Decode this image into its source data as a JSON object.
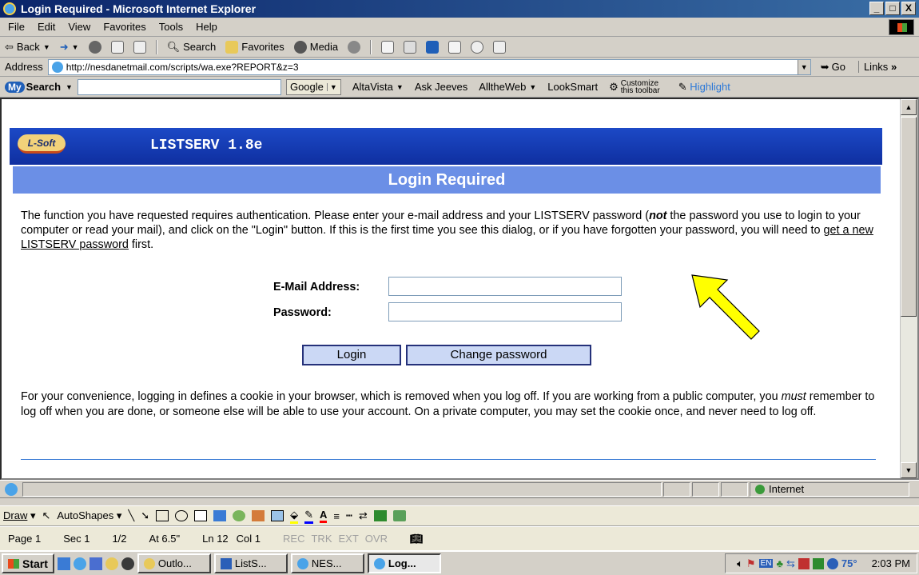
{
  "window": {
    "title": "Login Required - Microsoft Internet Explorer",
    "minimize": "_",
    "maximize": "□",
    "close": "X"
  },
  "menu": [
    "File",
    "Edit",
    "View",
    "Favorites",
    "Tools",
    "Help"
  ],
  "toolbar": {
    "back": "Back",
    "search": "Search",
    "favorites": "Favorites",
    "media": "Media"
  },
  "address": {
    "label": "Address",
    "url": "http://nesdanetmail.com/scripts/wa.exe?REPORT&z=3",
    "go": "Go",
    "links": "Links"
  },
  "searchbar": {
    "my": "My",
    "search": "Search",
    "google": "Google",
    "items": [
      "AltaVista",
      "Ask Jeeves",
      "AlltheWeb",
      "LookSmart"
    ],
    "customize": "Customize this toolbar",
    "highlight": "Highlight"
  },
  "page": {
    "logo": "L-Soft",
    "product": "LISTSERV 1.8e",
    "heading": "Login Required",
    "intro_before_not": "The function you have requested requires authentication. Please enter your e-mail address and your LISTSERV password (",
    "not_word": "not",
    "intro_after_not": " the password you use to login to your computer or read your mail), and click on the \"Login\" button. If this is the first time you see this dialog, or if you have forgotten your password, you will need to ",
    "intro_link": "get a new LISTSERV password",
    "intro_end": " first.",
    "email_label": "E-Mail Address:",
    "password_label": "Password:",
    "login_button": "Login",
    "change_password_button": "Change password",
    "conv_before_must": "For your convenience, logging in defines a cookie in your browser, which is removed when you log off. If you are working from a public computer, you ",
    "must_word": "must",
    "conv_after_must": " remember to log off when you are done, or someone else will be able to use your account. On a private computer, you may set the cookie once, and never need to log off."
  },
  "status": {
    "zone": "Internet"
  },
  "draw": {
    "draw": "Draw",
    "autoshapes": "AutoShapes"
  },
  "wordstatus": {
    "page": "Page 1",
    "sec": "Sec 1",
    "pages": "1/2",
    "at": "At 6.5\"",
    "ln": "Ln 12",
    "col": "Col 1",
    "rec": "REC",
    "trk": "TRK",
    "ext": "EXT",
    "ovr": "OVR"
  },
  "taskbar": {
    "start": "Start",
    "tasks": [
      "Outlo...",
      "ListS...",
      "NES...",
      "Log..."
    ],
    "lang": "EN",
    "temp": "75°",
    "time": "2:03 PM"
  },
  "colors": {
    "listserv_bar": "#1c49c6",
    "heading_bg": "#6b8fe6",
    "arrow": "#ffff00",
    "button_bg": "#cbd8f5"
  }
}
